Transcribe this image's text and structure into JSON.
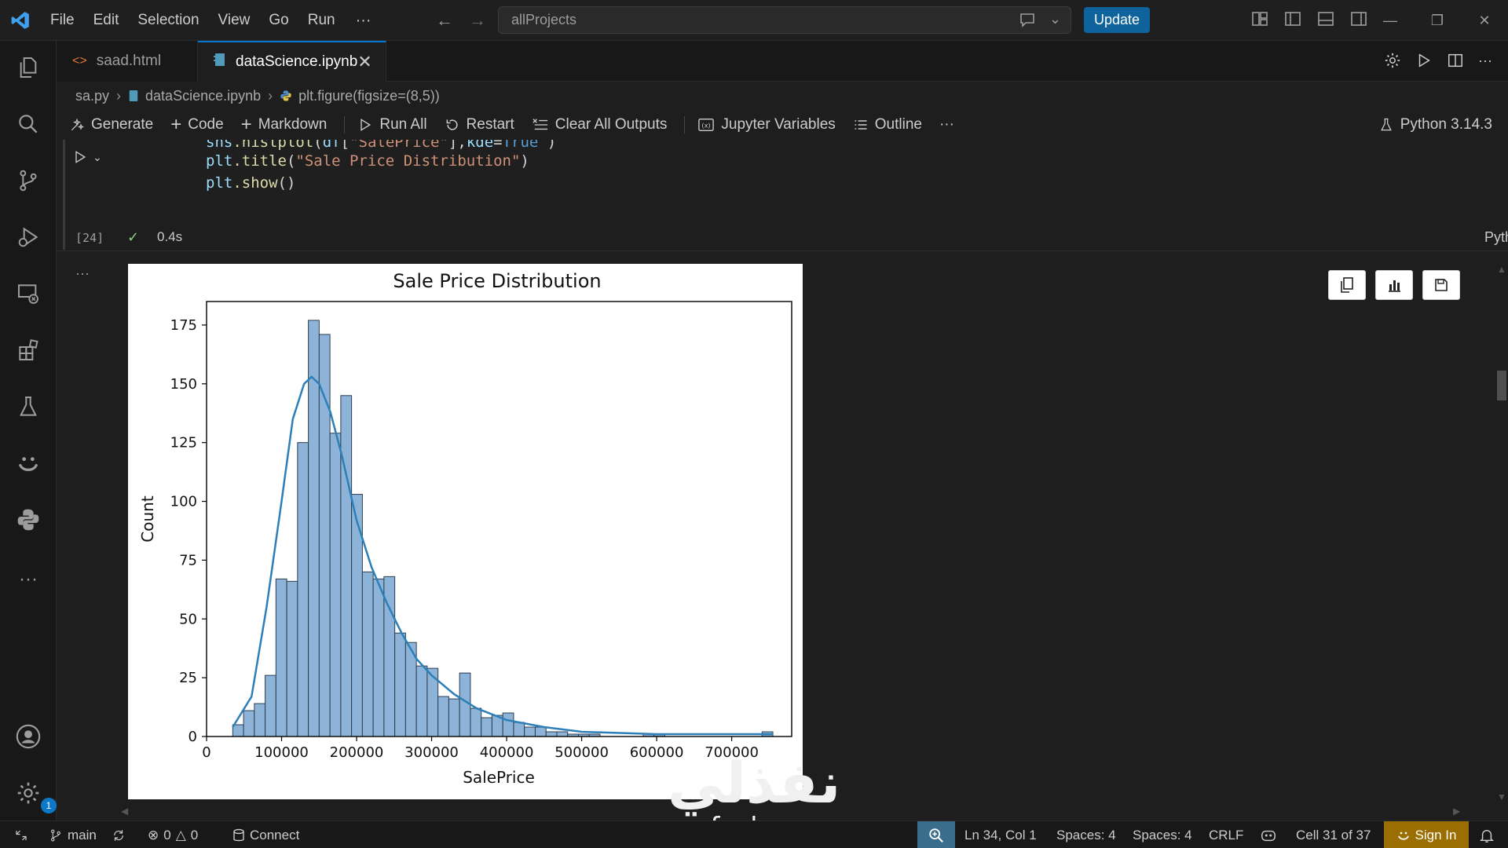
{
  "menu": [
    "File",
    "Edit",
    "Selection",
    "View",
    "Go",
    "Run",
    "···"
  ],
  "command_center": {
    "text": "allProjects"
  },
  "update_label": "Update",
  "tabs": [
    {
      "label": "saad.html",
      "icon": "html-icon",
      "active": false
    },
    {
      "label": "dataScience.ipynb",
      "icon": "notebook-icon",
      "active": true
    }
  ],
  "breadcrumb": [
    "sa.py",
    "dataScience.ipynb",
    "plt.figure(figsize=(8,5))"
  ],
  "toolbar": {
    "generate": "Generate",
    "code": "Code",
    "markdown": "Markdown",
    "run_all": "Run All",
    "restart": "Restart",
    "clear_outputs": "Clear All Outputs",
    "variables": "Jupyter Variables",
    "outline": "Outline",
    "more": "···",
    "kernel": "Python 3.14.3"
  },
  "cell": {
    "code_lines": [
      {
        "fn1": "sns",
        "fn2": ".histplot",
        "open": "(",
        "id": "df",
        "b1": "[",
        "str": "\"SalePrice\"",
        "b2": "],",
        "kw1": "kde",
        "eq": "=",
        "kw2": "True",
        "close": " )"
      },
      {
        "obj": "plt",
        "fn": ".title",
        "open": "(",
        "str": "\"Sale Price Distribution\"",
        "close": ")"
      },
      {
        "obj": "plt",
        "fn": ".show",
        "open": "()"
      }
    ],
    "exec_count": "[24]",
    "exec_time": "0.4s",
    "language": "Python",
    "out_dots": "···"
  },
  "chart_data": {
    "type": "bar",
    "title": "Sale Price Distribution",
    "xlabel": "SalePrice",
    "ylabel": "Count",
    "xlim": [
      0,
      780000
    ],
    "ylim": [
      0,
      185
    ],
    "xticks": [
      0,
      100000,
      200000,
      300000,
      400000,
      500000,
      600000,
      700000
    ],
    "yticks": [
      0,
      25,
      50,
      75,
      100,
      125,
      150,
      175
    ],
    "bin_width": 14400,
    "bin_start": 34900,
    "values": [
      5,
      11,
      14,
      26,
      67,
      66,
      125,
      177,
      171,
      129,
      145,
      103,
      70,
      67,
      68,
      44,
      40,
      30,
      29,
      17,
      16,
      27,
      12,
      8,
      9,
      10,
      6,
      4,
      4,
      2,
      2,
      1,
      1,
      1,
      0,
      0,
      0,
      0,
      1,
      1,
      0,
      0,
      0,
      0,
      0,
      0,
      0,
      0,
      0,
      2
    ],
    "kde": [
      [
        34900,
        4
      ],
      [
        60000,
        17
      ],
      [
        80000,
        55
      ],
      [
        100000,
        100
      ],
      [
        115000,
        135
      ],
      [
        130000,
        150
      ],
      [
        140000,
        153
      ],
      [
        150000,
        150
      ],
      [
        165000,
        138
      ],
      [
        180000,
        120
      ],
      [
        200000,
        92
      ],
      [
        220000,
        72
      ],
      [
        240000,
        57
      ],
      [
        260000,
        44
      ],
      [
        280000,
        33
      ],
      [
        300000,
        26
      ],
      [
        330000,
        18
      ],
      [
        360000,
        12
      ],
      [
        400000,
        7
      ],
      [
        450000,
        4
      ],
      [
        500000,
        2
      ],
      [
        600000,
        1
      ],
      [
        700000,
        1
      ],
      [
        755000,
        1
      ]
    ],
    "colors": {
      "bar_fill": "#8db4d8",
      "bar_edge": "#2c3e50",
      "kde": "#2c7fb8"
    }
  },
  "statusbar": {
    "branch": "main",
    "errors": "0",
    "warnings": "0",
    "connect": "Connect",
    "position": "Ln 34, Col 1",
    "spaces1": "Spaces: 4",
    "spaces2": "Spaces: 4",
    "eol": "CRLF",
    "cell": "Cell 31 of 37",
    "signin": "Sign In"
  },
  "activity_badge": "1",
  "watermark": {
    "arabic": "نفذلي",
    "latin": "nafezly.com"
  }
}
